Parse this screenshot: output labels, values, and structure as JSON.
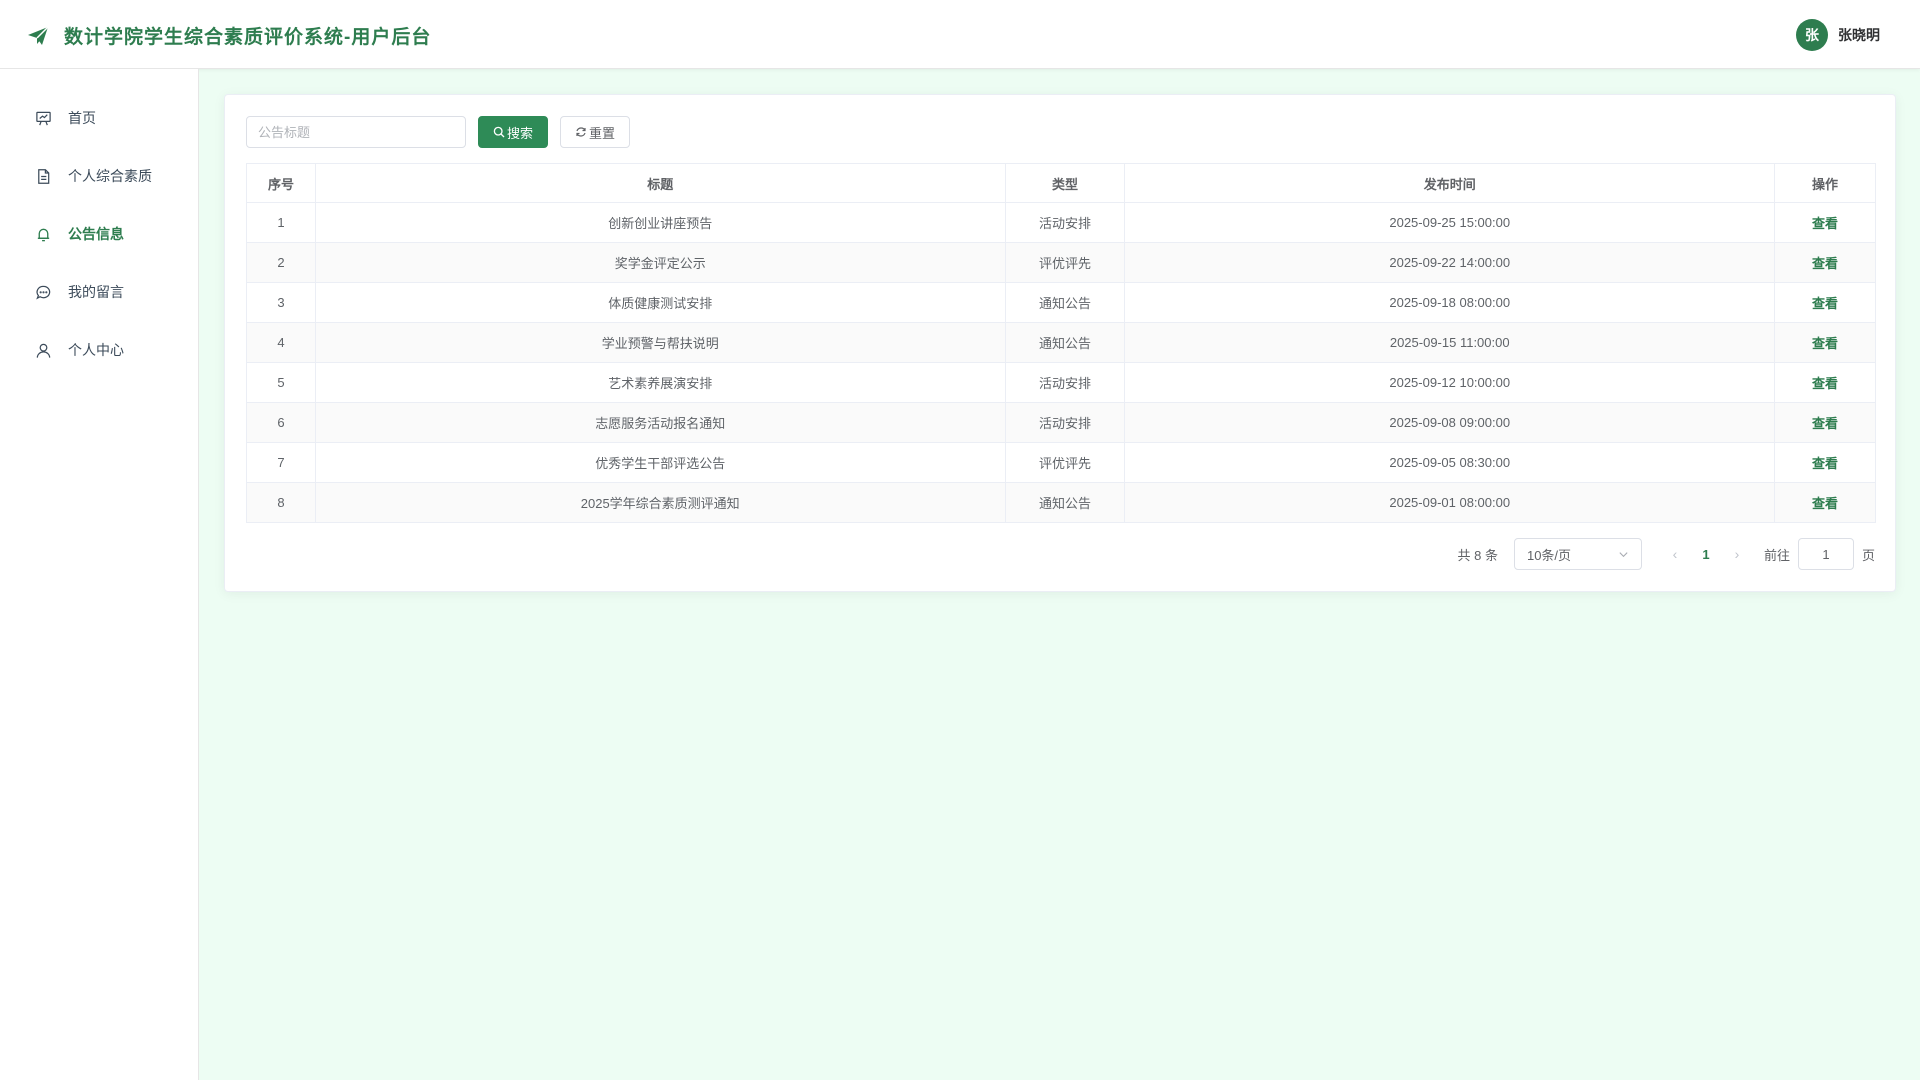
{
  "app": {
    "title": "数计学院学生综合素质评价系统-用户后台",
    "accent": "#2e7d4f",
    "background": "#edfdf3"
  },
  "user": {
    "avatar_char": "张",
    "name": "张晓明"
  },
  "sidebar": {
    "items": [
      {
        "label": "首页",
        "icon": "chart-board-icon",
        "active": false
      },
      {
        "label": "个人综合素质",
        "icon": "document-icon",
        "active": false
      },
      {
        "label": "公告信息",
        "icon": "bell-icon",
        "active": true
      },
      {
        "label": "我的留言",
        "icon": "chat-bubble-icon",
        "active": false
      },
      {
        "label": "个人中心",
        "icon": "user-icon",
        "active": false
      }
    ]
  },
  "toolbar": {
    "search_placeholder": "公告标题",
    "search_value": "",
    "search_label": "搜索",
    "reset_label": "重置"
  },
  "table": {
    "headers": [
      "序号",
      "标题",
      "类型",
      "发布时间",
      "操作"
    ],
    "action_label": "查看",
    "rows": [
      [
        "1",
        "创新创业讲座预告",
        "活动安排",
        "2025-09-25 15:00:00"
      ],
      [
        "2",
        "奖学金评定公示",
        "评优评先",
        "2025-09-22 14:00:00"
      ],
      [
        "3",
        "体质健康测试安排",
        "通知公告",
        "2025-09-18 08:00:00"
      ],
      [
        "4",
        "学业预警与帮扶说明",
        "通知公告",
        "2025-09-15 11:00:00"
      ],
      [
        "5",
        "艺术素养展演安排",
        "活动安排",
        "2025-09-12 10:00:00"
      ],
      [
        "6",
        "志愿服务活动报名通知",
        "活动安排",
        "2025-09-08 09:00:00"
      ],
      [
        "7",
        "优秀学生干部评选公告",
        "评优评先",
        "2025-09-05 08:30:00"
      ],
      [
        "8",
        "2025学年综合素质测评通知",
        "通知公告",
        "2025-09-01 08:00:00"
      ]
    ]
  },
  "pagination": {
    "total_text": "共 8 条",
    "page_size": "10条/页",
    "current_page": "1",
    "goto_label": "前往",
    "goto_value": "1",
    "page_unit": "页"
  }
}
